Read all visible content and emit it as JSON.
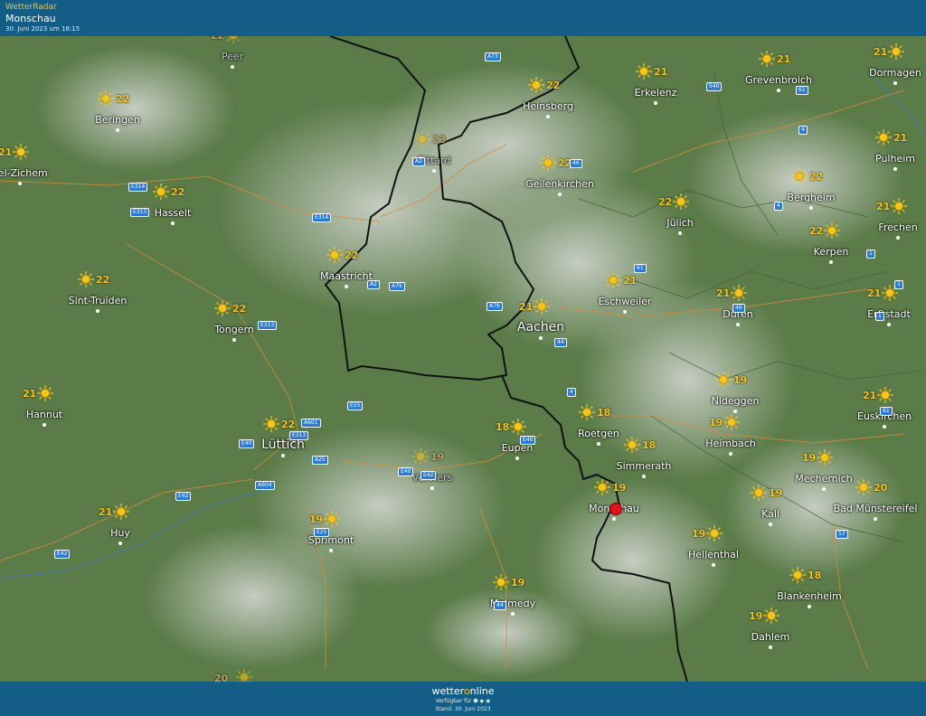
{
  "header": {
    "brand": "WetterRadar",
    "location": "Monschau",
    "timestamp": "30. Juni 2023 um 16:15"
  },
  "footer": {
    "logo_pre": "wetter",
    "logo_o": "o",
    "logo_post": "nline",
    "available": "Verfügbar für ⬢ ◆ ◉",
    "stand": "Stand: 30. Juni 2023"
  },
  "colors": {
    "header": "#135d87",
    "sun": "#f5c518",
    "pin": "#e0141b"
  },
  "cities": [
    {
      "name": "Peer",
      "temp": "22",
      "faded": true
    },
    {
      "name": "Beringen",
      "temp": "22"
    },
    {
      "name": "vel-Zichem",
      "temp": "21"
    },
    {
      "name": "Hasselt",
      "temp": "22"
    },
    {
      "name": "Sint-Truiden",
      "temp": "22"
    },
    {
      "name": "Tongern",
      "temp": "22"
    },
    {
      "name": "Maastricht",
      "temp": "22"
    },
    {
      "name": "Sittard",
      "temp": "23",
      "faded": true
    },
    {
      "name": "Heinsberg",
      "temp": "22"
    },
    {
      "name": "Erkelenz",
      "temp": "21"
    },
    {
      "name": "Grevenbroich",
      "temp": "21"
    },
    {
      "name": "Dormagen",
      "temp": "21"
    },
    {
      "name": "Geilenkirchen",
      "temp": "22"
    },
    {
      "name": "Pulheim",
      "temp": "21"
    },
    {
      "name": "Bergheim",
      "temp": "22"
    },
    {
      "name": "Jülich",
      "temp": "22"
    },
    {
      "name": "Frechen",
      "temp": "21"
    },
    {
      "name": "Kerpen",
      "temp": "22"
    },
    {
      "name": "Eschweiler",
      "temp": "21"
    },
    {
      "name": "Düren",
      "temp": "21"
    },
    {
      "name": "Erftstadt",
      "temp": "21"
    },
    {
      "name": "Aachen",
      "temp": "21",
      "big": true
    },
    {
      "name": "Hannut",
      "temp": "21"
    },
    {
      "name": "Lüttich",
      "temp": "22",
      "big": true
    },
    {
      "name": "Verviers",
      "temp": "19",
      "faded": true
    },
    {
      "name": "Eupen",
      "temp": "18"
    },
    {
      "name": "Roetgen",
      "temp": "18"
    },
    {
      "name": "Simmerath",
      "temp": "18"
    },
    {
      "name": "Nideggen",
      "temp": "19"
    },
    {
      "name": "Heimbach",
      "temp": "19"
    },
    {
      "name": "Euskirchen",
      "temp": "21"
    },
    {
      "name": "Mechernich",
      "temp": "19"
    },
    {
      "name": "Monschau",
      "temp": "19"
    },
    {
      "name": "Kall",
      "temp": "19"
    },
    {
      "name": "Bad Münstereifel",
      "temp": "20"
    },
    {
      "name": "Huy",
      "temp": "21"
    },
    {
      "name": "Sprimont",
      "temp": "19"
    },
    {
      "name": "Hellenthal",
      "temp": "19"
    },
    {
      "name": "Blankenheim",
      "temp": "18"
    },
    {
      "name": "Malmedy",
      "temp": "19"
    },
    {
      "name": "Dahlem",
      "temp": "19"
    }
  ],
  "extra_temps": [
    "20"
  ],
  "roads": [
    "A73",
    "A2",
    "E314",
    "E313",
    "E314",
    "46",
    "A2",
    "A79",
    "A76",
    "E313",
    "E25",
    "A601",
    "E313",
    "E40",
    "A25",
    "A604",
    "E40",
    "E42",
    "E40",
    "E42",
    "E25",
    "E42",
    "44",
    "4",
    "44",
    "61",
    "46",
    "540",
    "61",
    "4",
    "4",
    "1",
    "61",
    "1",
    "1",
    "57"
  ]
}
